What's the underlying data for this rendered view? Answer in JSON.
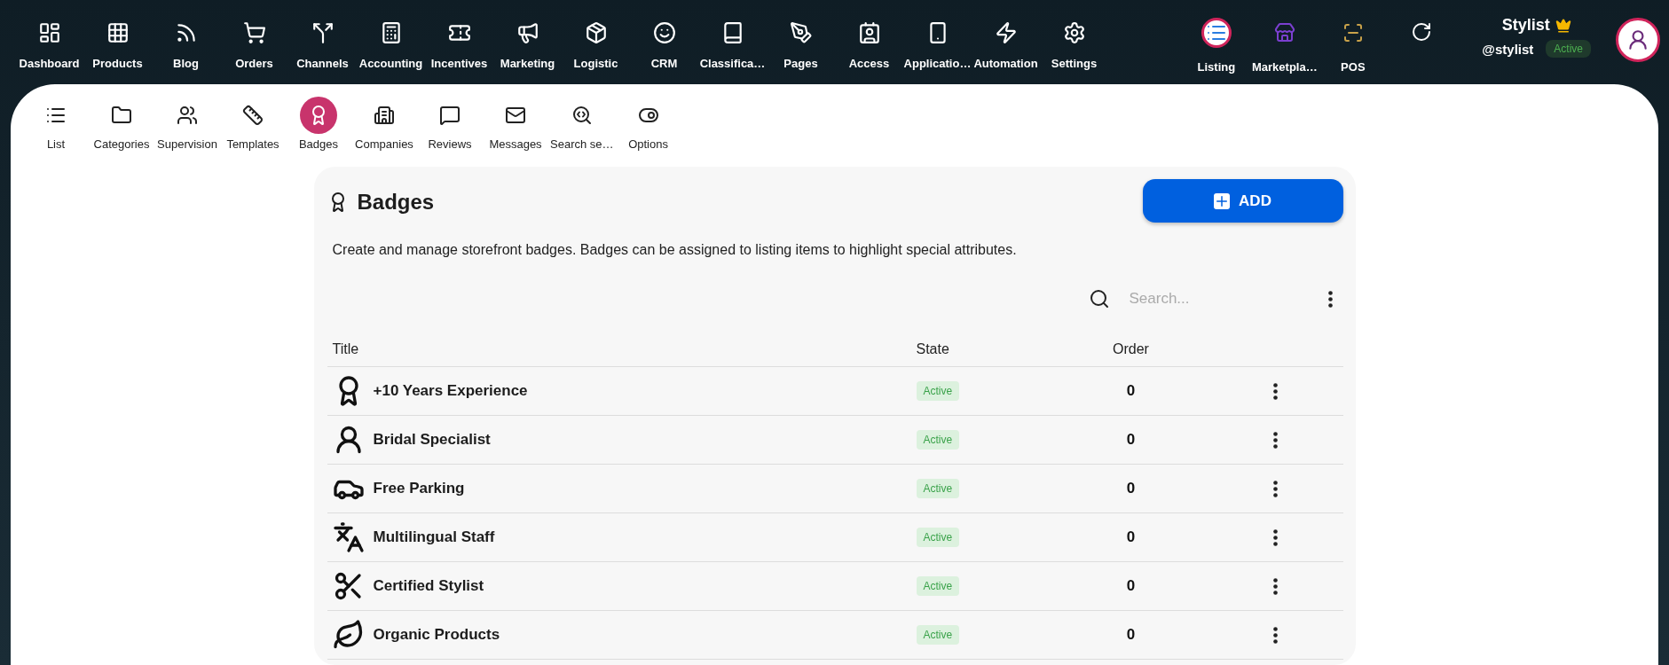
{
  "top_nav": {
    "items": [
      {
        "label": "Dashboard"
      },
      {
        "label": "Products"
      },
      {
        "label": "Blog"
      },
      {
        "label": "Orders"
      },
      {
        "label": "Channels"
      },
      {
        "label": "Accounting"
      },
      {
        "label": "Incentives"
      },
      {
        "label": "Marketing"
      },
      {
        "label": "Logistic"
      },
      {
        "label": "CRM"
      },
      {
        "label": "Classifica…"
      },
      {
        "label": "Pages"
      },
      {
        "label": "Access"
      },
      {
        "label": "Applicatio…"
      },
      {
        "label": "Automation"
      },
      {
        "label": "Settings"
      }
    ],
    "apps": [
      {
        "label": "Listing",
        "selected": true
      },
      {
        "label": "Marketpla…",
        "selected": false
      },
      {
        "label": "POS",
        "selected": false
      }
    ]
  },
  "user": {
    "name": "Stylist",
    "handle": "@stylist",
    "status": "Active"
  },
  "sub_tabs": [
    {
      "label": "List",
      "selected": false
    },
    {
      "label": "Categories",
      "selected": false
    },
    {
      "label": "Supervision",
      "selected": false
    },
    {
      "label": "Templates",
      "selected": false
    },
    {
      "label": "Badges",
      "selected": true
    },
    {
      "label": "Companies",
      "selected": false
    },
    {
      "label": "Reviews",
      "selected": false
    },
    {
      "label": "Messages",
      "selected": false
    },
    {
      "label": "Search se…",
      "selected": false
    },
    {
      "label": "Options",
      "selected": false
    }
  ],
  "card": {
    "title": "Badges",
    "add_button": "ADD",
    "description": "Create and manage storefront badges. Badges can be assigned to listing items to highlight special attributes.",
    "search": {
      "placeholder": "Search..."
    },
    "table": {
      "columns": [
        "Title",
        "State",
        "Order"
      ],
      "rows": [
        {
          "title": "+10 Years Experience",
          "state": "Active",
          "order": "0"
        },
        {
          "title": "Bridal Specialist",
          "state": "Active",
          "order": "0"
        },
        {
          "title": "Free Parking",
          "state": "Active",
          "order": "0"
        },
        {
          "title": "Multilingual Staff",
          "state": "Active",
          "order": "0"
        },
        {
          "title": "Certified Stylist",
          "state": "Active",
          "order": "0"
        },
        {
          "title": "Organic Products",
          "state": "Active",
          "order": "0"
        }
      ]
    }
  }
}
